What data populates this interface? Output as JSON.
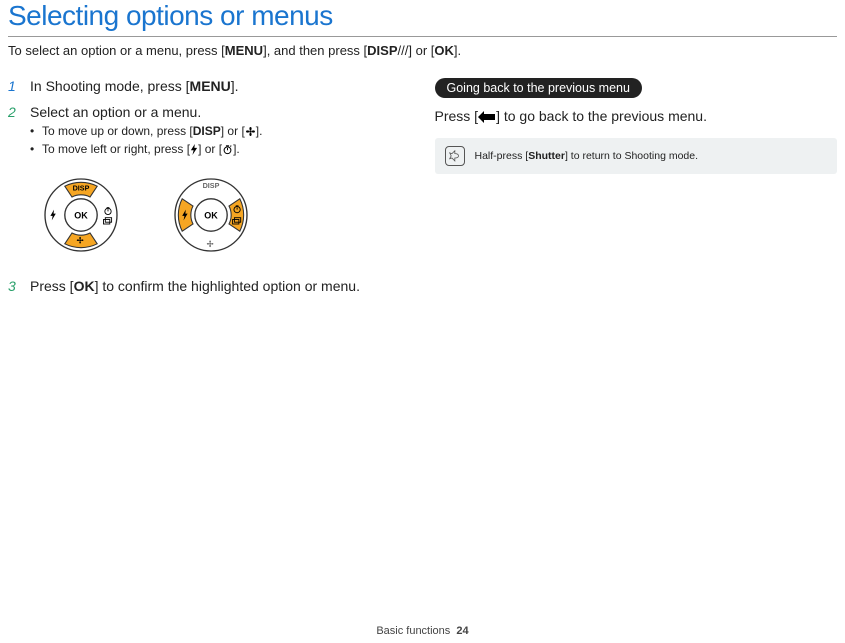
{
  "title": "Selecting options or menus",
  "intro": {
    "prefix": "To select an option or a menu, press [",
    "menu_glyph": "MENU",
    "mid1": "], and then press [",
    "disp_glyph": "DISP",
    "combo_mid": "/",
    "mid2": "] or [",
    "ok_glyph": "OK",
    "suffix": "]."
  },
  "left": {
    "step1": {
      "num": "1",
      "prefix": "In Shooting mode, press [",
      "glyph": "MENU",
      "suffix": "]."
    },
    "step2": {
      "num": "2",
      "text": "Select an option or a menu.",
      "bullet1": {
        "prefix": "To move up or down, press [",
        "g1": "DISP",
        "mid": "] or [",
        "suffix": "]."
      },
      "bullet2": {
        "prefix": "To move left or right, press [",
        "mid": "] or [",
        "suffix": "]."
      }
    },
    "step3": {
      "num": "3",
      "prefix": "Press [",
      "glyph": "OK",
      "suffix": "] to confirm the highlighted option or menu."
    },
    "dial": {
      "disp": "DISP",
      "ok": "OK"
    }
  },
  "right": {
    "pill": "Going back to the previous menu",
    "press_prefix": "Press [",
    "press_suffix": "] to go back to the previous menu.",
    "note_prefix": "Half-press [",
    "note_bold": "Shutter",
    "note_suffix": "] to return to Shooting mode."
  },
  "footer": {
    "section": "Basic functions",
    "page": "24"
  }
}
